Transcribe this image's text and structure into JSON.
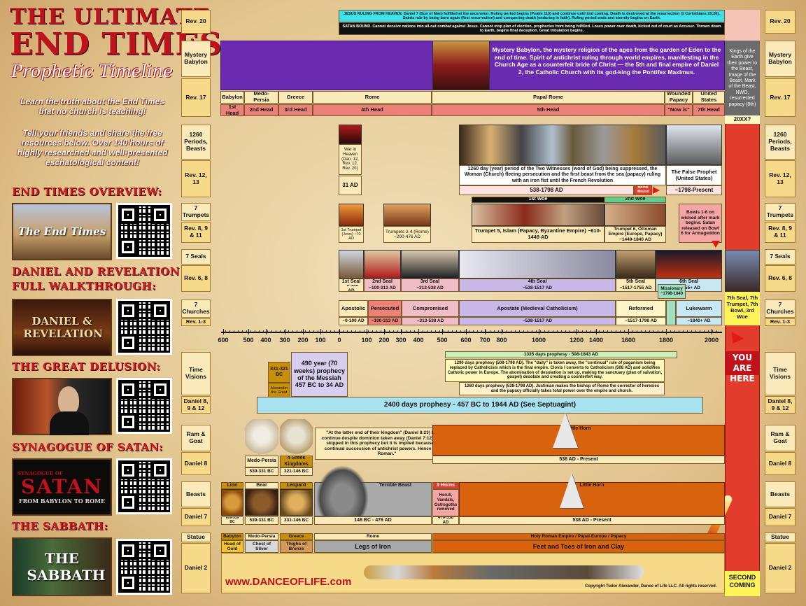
{
  "title": {
    "line1": "THE ULTIMATE",
    "line2": "END TIMES",
    "line3": "Prophetic Timeline"
  },
  "intro": {
    "text1": "Learn the truth about the End Times that no church is teaching!",
    "text2": "Tell your friends and share the free resources below. Over 140 hours of highly researched and well-presented eschatological content!"
  },
  "sections": [
    {
      "heading": "END TIMES OVERVIEW:",
      "thumb": "The End Times"
    },
    {
      "heading": "DANIEL AND REVELATION FULL WALKTHROUGH:",
      "thumb": "DANIEL & REVELATION"
    },
    {
      "heading": "THE GREAT DELUSION:",
      "thumb": ""
    },
    {
      "heading": "SYNAGOGUE OF SATAN:",
      "thumb": "SATAN",
      "thumb_sub": "FROM BABYLON TO ROME",
      "thumb_top": "SYNAGOGUE OF"
    },
    {
      "heading": "THE SABBATH:",
      "thumb": "THE SABBATH"
    }
  ],
  "left_labels": {
    "rev20": "Rev. 20",
    "mystery": "Mystery Babylon",
    "rev17": "Rev. 17",
    "periods": "1260 Periods, Beasts",
    "rev1213": "Rev. 12, 13",
    "trumpets": "7 Trumpets",
    "rev89": "Rev. 8, 9 & 11",
    "seals": "7 Seals",
    "rev68": "Rev. 6, 8",
    "churches": "7 Churches",
    "rev13": "Rev. 1-3",
    "time_visions": "Time Visions",
    "dan89": "Daniel 8, 9 & 12",
    "ram": "Ram & Goat",
    "dan8": "Daniel 8",
    "beasts": "Beasts",
    "dan7": "Daniel 7",
    "statue": "Statue",
    "dan2": "Daniel 2"
  },
  "rev20": {
    "cyan": "JESUS RULING FROM HEAVEN. Daniel 7 (Son of Man) fulfilled at the ascension. Ruling period begins (Psalm 110) and continue until 2nd coming. Death is destroyed at the resurrection (1 Corinthians 15:26). Saints rule by being born again (first resurrection) and conquering death (enduring in faith). Ruling period ends and eternity begins on Earth.",
    "black": "SATAN BOUND. Cannot deceive nations into all-out combat against Jesus. Cannot stop plan of election, prophecies from being fulfilled. Loses power over death, kicked out of court as Accuser. Thrown down to Earth, begins final deception. Great tribulation begins."
  },
  "mystery_text": "Mystery Babylon, the mystery religion of the ages from the garden of Eden to the end of time. Spirit of antichrist ruling through world empires, manifesting in the Church Age as a counterfeit bride of Christ — the 5th and final empire of Daniel 2, the Catholic Church with its god-king the Pontifex Maximus.",
  "red_column": {
    "kings": "Kings of the Earth give their power to the Beast, Image of the Beast, Mark of the Beast, NWO, resurrected papacy (8th)",
    "year": "20XX?",
    "seal7": "7th Seal, 7th Trumpet, 7th Bowl, 3rd Woe",
    "here": "YOU ARE HERE",
    "second": "SECOND COMING"
  },
  "rev17": {
    "empires": [
      "Babylon",
      "Medo-Persia",
      "Greece",
      "Rome",
      "Papal Rome",
      "Wounded Papacy",
      "United States"
    ],
    "heads": [
      "1st Head",
      "2nd Head",
      "3rd Head",
      "4th Head",
      "5th Head",
      "\"Now is\"",
      "7th Head"
    ]
  },
  "beasts_row": {
    "war": "War in Heaven (Dan. 12, Rev. 12, Rev. 20)",
    "ad31": "31 AD",
    "witnesses": "1260 day (year) period of the Two Witnesses (word of God) being suppressed, the Woman (Church) fleeing persecution and the first beast from the sea (papacy) ruling with an iron fist until the French Revolution",
    "false_prophet": "The False Prophet (United States)",
    "years": "538-1798 AD",
    "mortal": "Mortal Wound",
    "present": "~1798-Present"
  },
  "trumpets_row": {
    "woe1": "1st Woe",
    "woe2": "2nd Woe",
    "t1": "1st Trumpet (Jews) ~70 AD",
    "t24": "Trumpets 2-4 (Rome) ~200-476 AD",
    "t5": "Trumpet 5, Islam (Papacy, Byzantine Empire) ~610-1449 AD",
    "t6": "Trumpet 6, Ottoman Empire (Europe, Papacy) ~1449-1840 AD",
    "bowls": "Bowls 1-6 on wicked after mark begins. Satan released on Bowl 6 for Armageddon"
  },
  "seals_row": [
    {
      "name": "1st Seal",
      "date": "~0-100 AD"
    },
    {
      "name": "2nd Seal",
      "date": "~100-313 AD"
    },
    {
      "name": "3rd Seal",
      "date": "~313-538 AD"
    },
    {
      "name": "4th Seal",
      "date": "~538-1517 AD"
    },
    {
      "name": "5th Seal",
      "date": "~1517-1755 AD"
    },
    {
      "name": "6th Seal",
      "date": "~1755+ AD"
    }
  ],
  "missionary": "Missionary ~1798-1840",
  "churches_row": [
    {
      "name": "Apostolic",
      "date": "~0-100 AD"
    },
    {
      "name": "Persecuted",
      "date": "~100-313 AD"
    },
    {
      "name": "Compromised",
      "date": "~313-538 AD"
    },
    {
      "name": "Apostate (Medieval Catholicism)",
      "date": "~538-1517 AD"
    },
    {
      "name": "Reformed",
      "date": "~1517-1798 AD"
    },
    {
      "name": "Lukewarm",
      "date": "~1840+ AD"
    }
  ],
  "axis_labels": [
    "600",
    "500",
    "400",
    "300",
    "200",
    "100",
    "0",
    "100",
    "200",
    "300",
    "400",
    "500",
    "600",
    "700",
    "800",
    "1000",
    "1200",
    "1400",
    "1600",
    "1800",
    "2000"
  ],
  "time_visions": {
    "d1335": "1335 days prophesy - 508-1843 AD",
    "d1290": "1290 days prophesy (508-1798 AD). The \"daily\" is taken away, the \"continual\" rule of paganism being replaced by Catholicism which is the final empire. Clovis I converts to Catholicism (508 AD) and solidifies Catholic power in Europe. The abomination of desolation is set up, making the sanctuary (plan of salvation, gospel) desolate and creating a counterfeit way.",
    "d1260": "1260 days prophecy (538-1798 AD). Justinian makes the bishop of Rome the corrector of heresies and the papacy officially takes total power over the empire and church.",
    "alex_years": "331-321 BC",
    "alex": "Alexander the Great",
    "weeks": "490 year (70 weeks) prophecy of the Messiah 457 BC to 34 AD",
    "d2400": "2400 days prophesy - 457 BC to 1944 AD (See Septuagint)"
  },
  "ram_row": {
    "medo": "Medo-Persia",
    "medo_years": "539-331 BC",
    "greek": "4 Greek Kingdoms",
    "greek_years": "321-146 BC",
    "quote": "\"At the latter end of their kingdom\" (Daniel 8:23) Powers continue despite dominion taken away (Daniel 7:12) Rome is skipped in this prophecy but it is implied because of the continual succession of antichrist powers. Hence \"Greco-Roman.\"",
    "horn": "Little Horn",
    "horn_years": "538 AD - Present"
  },
  "beasts7": {
    "lion": "Lion",
    "lion_years": "609-539 BC",
    "bear": "Bear",
    "bear_years": "539-331 BC",
    "leopard": "Leopard",
    "leopard_years": "331-146 BC",
    "terrible": "Terrible Beast",
    "terrible_years": "146 BC - 476 AD",
    "horns3": "3 Horns",
    "horns3_desc": "Heruli, Vandals, Ostrogoths removed",
    "horns3_years": "476-538 AD",
    "horn": "Little Horn",
    "horn_years": "538 AD - Present"
  },
  "statue_row": {
    "babylon": "Babylon",
    "gold": "Head of Gold",
    "medo": "Medo-Persia",
    "silver": "Chest of Silver",
    "greece": "Greece",
    "bronze": "Thighs of Bronze",
    "rome": "Rome",
    "iron": "Legs of Iron",
    "hre": "Holy Roman Empire / Papal Europe / Papacy",
    "feet": "Feet and Toes of Iron and Clay"
  },
  "website": "www.DANCEOFLIFE.com",
  "copyright": "Copyright Tudor Alexander, Dance of Life LLC. All rights reserved.",
  "colors": {
    "purple": "#6a2bb0",
    "red": "#e23d2c",
    "salmon": "#ec8178",
    "lavender": "#c7b8e8",
    "pink": "#f0bcc6",
    "cream": "#fbeab9",
    "blue": "#c8e7f5",
    "orange": "#d9620f",
    "yellow": "#f7d98a"
  }
}
